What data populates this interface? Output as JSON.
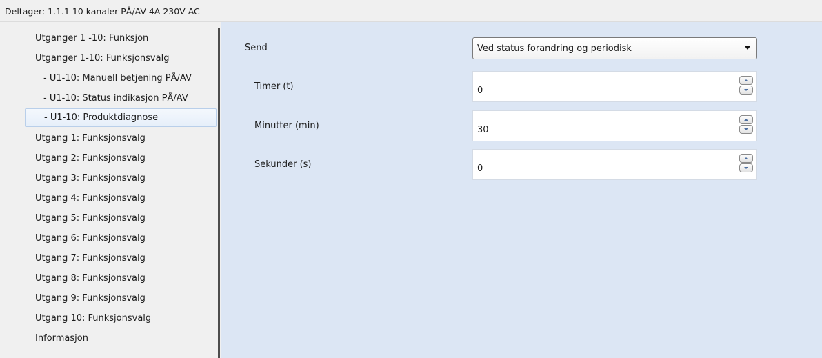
{
  "header": {
    "title": "Deltager: 1.1.1  10 kanaler PÅ/AV 4A 230V AC"
  },
  "sidebar": {
    "items": [
      {
        "label": "Utganger 1 -10: Funksjon"
      },
      {
        "label": "Utganger 1-10: Funksjonsvalg"
      },
      {
        "label": "- U1-10: Manuell betjening PÅ/AV"
      },
      {
        "label": "- U1-10: Status indikasjon PÅ/AV"
      },
      {
        "label": "- U1-10: Produktdiagnose",
        "selected": true
      },
      {
        "label": "Utgang 1: Funksjonsvalg"
      },
      {
        "label": "Utgang 2: Funksjonsvalg"
      },
      {
        "label": "Utgang 3: Funksjonsvalg"
      },
      {
        "label": "Utgang 4: Funksjonsvalg"
      },
      {
        "label": "Utgang 5: Funksjonsvalg"
      },
      {
        "label": "Utgang 6: Funksjonsvalg"
      },
      {
        "label": "Utgang 7: Funksjonsvalg"
      },
      {
        "label": "Utgang 8: Funksjonsvalg"
      },
      {
        "label": "Utgang 9: Funksjonsvalg"
      },
      {
        "label": "Utgang 10: Funksjonsvalg"
      },
      {
        "label": "Informasjon"
      }
    ]
  },
  "form": {
    "send": {
      "label": "Send",
      "value": "Ved status forandring og periodisk"
    },
    "timer": {
      "label": "Timer (t)",
      "value": "0"
    },
    "minutter": {
      "label": "Minutter (min)",
      "value": "30"
    },
    "sekunder": {
      "label": "Sekunder (s)",
      "value": "0"
    }
  },
  "icons": {
    "dropdown": "chevron-down-icon",
    "spin_up": "arrow-up-icon",
    "spin_down": "arrow-down-icon"
  },
  "colors": {
    "panel_background": "#dce6f4",
    "sidebar_background": "#f0f0f0",
    "selection_border": "#b9cfea",
    "splitter": "#4d4d4d"
  }
}
